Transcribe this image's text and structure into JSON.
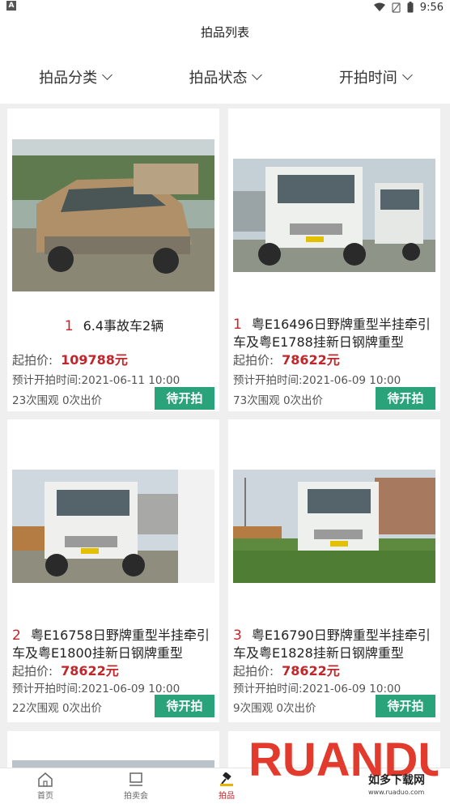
{
  "status_bar": {
    "carrier_icon": "A",
    "time": "9:56"
  },
  "header": {
    "title": "拍品列表"
  },
  "filters": [
    {
      "label": "拍品分类"
    },
    {
      "label": "拍品状态"
    },
    {
      "label": "开拍时间"
    }
  ],
  "items": [
    {
      "index": "1",
      "title": "6.4事故车2辆",
      "price_label": "起拍价:",
      "price": "109788元",
      "time_text": "预计开拍时间:2021-06-11 10:00",
      "stats": "23次围观  0次出价",
      "status": "待开拍"
    },
    {
      "index": "1",
      "title": "粤E16496日野牌重型半挂牵引车及粤E1788挂新日钢牌重型",
      "price_label": "起拍价:",
      "price": "78622元",
      "time_text": "预计开拍时间:2021-06-09 10:00",
      "stats": "73次围观  0次出价",
      "status": "待开拍"
    },
    {
      "index": "2",
      "title": "粤E16758日野牌重型半挂牵引车及粤E1800挂新日钢牌重型",
      "price_label": "起拍价:",
      "price": "78622元",
      "time_text": "预计开拍时间:2021-06-09 10:00",
      "stats": "22次围观  0次出价",
      "status": "待开拍"
    },
    {
      "index": "3",
      "title": "粤E16790日野牌重型半挂牵引车及粤E1828挂新日钢牌重型",
      "price_label": "起拍价:",
      "price": "78622元",
      "time_text": "预计开拍时间:2021-06-09 10:00",
      "stats": "9次围观  0次出价",
      "status": "待开拍"
    }
  ],
  "nav": [
    {
      "label": "首页",
      "icon": "home-icon"
    },
    {
      "label": "拍卖会",
      "icon": "monitor-icon"
    },
    {
      "label": "拍品",
      "icon": "gavel-icon"
    }
  ],
  "watermark": {
    "brand": "RUANDUO",
    "name": "如多下载网",
    "url": "www.ruaduo.com"
  },
  "colors": {
    "accent_red": "#c0262a",
    "button_green": "#2aa37a",
    "background": "#efefef"
  }
}
